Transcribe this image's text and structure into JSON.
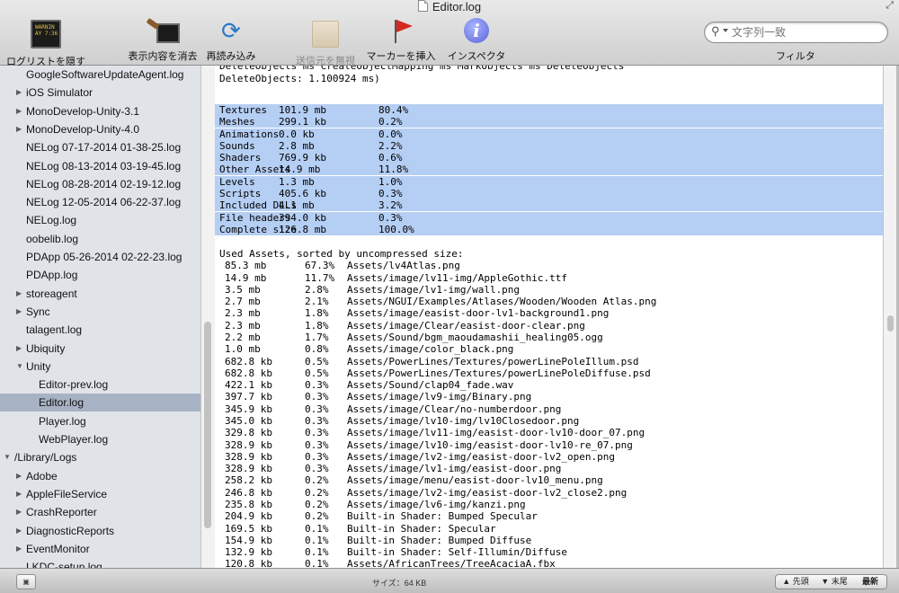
{
  "window": {
    "title": "Editor.log"
  },
  "toolbar": {
    "hide_log_list": "ログリストを隠す",
    "console_icon_text": "WARNIN\nAY 7:36",
    "clear_display": "表示内容を消去",
    "clear_icon_text": "7:36",
    "reload": "再読み込み",
    "ignore_sender": "送信元を無視",
    "insert_marker": "マーカーを挿入",
    "inspector": "インスペクタ",
    "search_placeholder": "文字列一致",
    "filter_label": "フィルタ"
  },
  "sidebar": {
    "items": [
      {
        "label": "GoogleSoftwareUpdateAgent.log",
        "indent": 1,
        "disclosure": "",
        "selected": false
      },
      {
        "label": "iOS Simulator",
        "indent": 1,
        "disclosure": "▶",
        "selected": false
      },
      {
        "label": "MonoDevelop-Unity-3.1",
        "indent": 1,
        "disclosure": "▶",
        "selected": false
      },
      {
        "label": "MonoDevelop-Unity-4.0",
        "indent": 1,
        "disclosure": "▶",
        "selected": false
      },
      {
        "label": "NELog 07-17-2014 01-38-25.log",
        "indent": 1,
        "disclosure": "",
        "selected": false
      },
      {
        "label": "NELog 08-13-2014 03-19-45.log",
        "indent": 1,
        "disclosure": "",
        "selected": false
      },
      {
        "label": "NELog 08-28-2014 02-19-12.log",
        "indent": 1,
        "disclosure": "",
        "selected": false
      },
      {
        "label": "NELog 12-05-2014 06-22-37.log",
        "indent": 1,
        "disclosure": "",
        "selected": false
      },
      {
        "label": "NELog.log",
        "indent": 1,
        "disclosure": "",
        "selected": false
      },
      {
        "label": "oobelib.log",
        "indent": 1,
        "disclosure": "",
        "selected": false
      },
      {
        "label": "PDApp 05-26-2014 02-22-23.log",
        "indent": 1,
        "disclosure": "",
        "selected": false
      },
      {
        "label": "PDApp.log",
        "indent": 1,
        "disclosure": "",
        "selected": false
      },
      {
        "label": "storeagent",
        "indent": 1,
        "disclosure": "▶",
        "selected": false
      },
      {
        "label": "Sync",
        "indent": 1,
        "disclosure": "▶",
        "selected": false
      },
      {
        "label": "talagent.log",
        "indent": 1,
        "disclosure": "",
        "selected": false
      },
      {
        "label": "Ubiquity",
        "indent": 1,
        "disclosure": "▶",
        "selected": false
      },
      {
        "label": "Unity",
        "indent": 1,
        "disclosure": "▼",
        "selected": false
      },
      {
        "label": "Editor-prev.log",
        "indent": 2,
        "disclosure": "",
        "selected": false
      },
      {
        "label": "Editor.log",
        "indent": 2,
        "disclosure": "",
        "selected": true
      },
      {
        "label": "Player.log",
        "indent": 2,
        "disclosure": "",
        "selected": false
      },
      {
        "label": "WebPlayer.log",
        "indent": 2,
        "disclosure": "",
        "selected": false
      },
      {
        "label": "/Library/Logs",
        "indent": 0,
        "disclosure": "▼",
        "selected": false
      },
      {
        "label": "Adobe",
        "indent": 1,
        "disclosure": "▶",
        "selected": false
      },
      {
        "label": "AppleFileService",
        "indent": 1,
        "disclosure": "▶",
        "selected": false
      },
      {
        "label": "CrashReporter",
        "indent": 1,
        "disclosure": "▶",
        "selected": false
      },
      {
        "label": "DiagnosticReports",
        "indent": 1,
        "disclosure": "▶",
        "selected": false
      },
      {
        "label": "EventMonitor",
        "indent": 1,
        "disclosure": "▶",
        "selected": false
      },
      {
        "label": "LKDC-setup.log",
        "indent": 1,
        "disclosure": "",
        "selected": false
      }
    ]
  },
  "log": {
    "intro_lines": [
      "DeleteObjects ms CreateObjectMapping ms MarkObjects ms DeleteObjects",
      "DeleteObjects: 1.100924 ms)"
    ],
    "size_table": [
      [
        "Textures",
        "101.9 mb",
        "80.4%"
      ],
      [
        "Meshes",
        "299.1 kb",
        "0.2%"
      ],
      [
        "Animations",
        "0.0 kb",
        "0.0%"
      ],
      [
        "Sounds",
        "2.8 mb",
        "2.2%"
      ],
      [
        "Shaders",
        "769.9 kb",
        "0.6%"
      ],
      [
        "Other Assets",
        "14.9 mb",
        "11.8%"
      ],
      [
        "Levels",
        "1.3 mb",
        "1.0%"
      ],
      [
        "Scripts",
        "405.6 kb",
        "0.3%"
      ],
      [
        "Included DLLs",
        "4.1 mb",
        "3.2%"
      ],
      [
        "File headers",
        "394.0 kb",
        "0.3%"
      ],
      [
        "Complete size",
        "126.8 mb",
        "100.0%"
      ]
    ],
    "assets_header": "Used Assets, sorted by uncompressed size:",
    "assets": [
      [
        "85.3 mb",
        "67.3%",
        "Assets/lv4Atlas.png"
      ],
      [
        "14.9 mb",
        "11.7%",
        "Assets/image/lv11-img/AppleGothic.ttf"
      ],
      [
        "3.5 mb",
        "2.8%",
        "Assets/image/lv1-img/wall.png"
      ],
      [
        "2.7 mb",
        "2.1%",
        "Assets/NGUI/Examples/Atlases/Wooden/Wooden Atlas.png"
      ],
      [
        "2.3 mb",
        "1.8%",
        "Assets/image/easist-door-lv1-background1.png"
      ],
      [
        "2.3 mb",
        "1.8%",
        "Assets/image/Clear/easist-door-clear.png"
      ],
      [
        "2.2 mb",
        "1.7%",
        "Assets/Sound/bgm_maoudamashii_healing05.ogg"
      ],
      [
        "1.0 mb",
        "0.8%",
        "Assets/image/color_black.png"
      ],
      [
        "682.8 kb",
        "0.5%",
        "Assets/PowerLines/Textures/powerLinePoleIllum.psd"
      ],
      [
        "682.8 kb",
        "0.5%",
        "Assets/PowerLines/Textures/powerLinePoleDiffuse.psd"
      ],
      [
        "422.1 kb",
        "0.3%",
        "Assets/Sound/clap04_fade.wav"
      ],
      [
        "397.7 kb",
        "0.3%",
        "Assets/image/lv9-img/Binary.png"
      ],
      [
        "345.9 kb",
        "0.3%",
        "Assets/image/Clear/no-numberdoor.png"
      ],
      [
        "345.0 kb",
        "0.3%",
        "Assets/image/lv10-img/lv10Closedoor.png"
      ],
      [
        "329.8 kb",
        "0.3%",
        "Assets/image/lv11-img/easist-door-lv10-door_07.png"
      ],
      [
        "328.9 kb",
        "0.3%",
        "Assets/image/lv10-img/easist-door-lv10-re_07.png"
      ],
      [
        "328.9 kb",
        "0.3%",
        "Assets/image/lv2-img/easist-door-lv2_open.png"
      ],
      [
        "328.9 kb",
        "0.3%",
        "Assets/image/lv1-img/easist-door.png"
      ],
      [
        "258.2 kb",
        "0.2%",
        "Assets/image/menu/easist-door-lv10_menu.png"
      ],
      [
        "246.8 kb",
        "0.2%",
        "Assets/image/lv2-img/easist-door-lv2_close2.png"
      ],
      [
        "235.8 kb",
        "0.2%",
        "Assets/image/lv6-img/kanzi.png"
      ],
      [
        "204.9 kb",
        "0.2%",
        "Built-in Shader: Bumped Specular"
      ],
      [
        "169.5 kb",
        "0.1%",
        "Built-in Shader: Specular"
      ],
      [
        "154.9 kb",
        "0.1%",
        "Built-in Shader: Bumped Diffuse"
      ],
      [
        "132.9 kb",
        "0.1%",
        "Built-in Shader: Self-Illumin/Diffuse"
      ],
      [
        "120.8 kb",
        "0.1%",
        "Assets/AfricanTrees/TreeAcaciaA.fbx"
      ]
    ]
  },
  "statusbar": {
    "size": "サイズ：64 KB",
    "prev": "▲ 先頭",
    "next": "▼ 末尾",
    "latest": "最新"
  }
}
